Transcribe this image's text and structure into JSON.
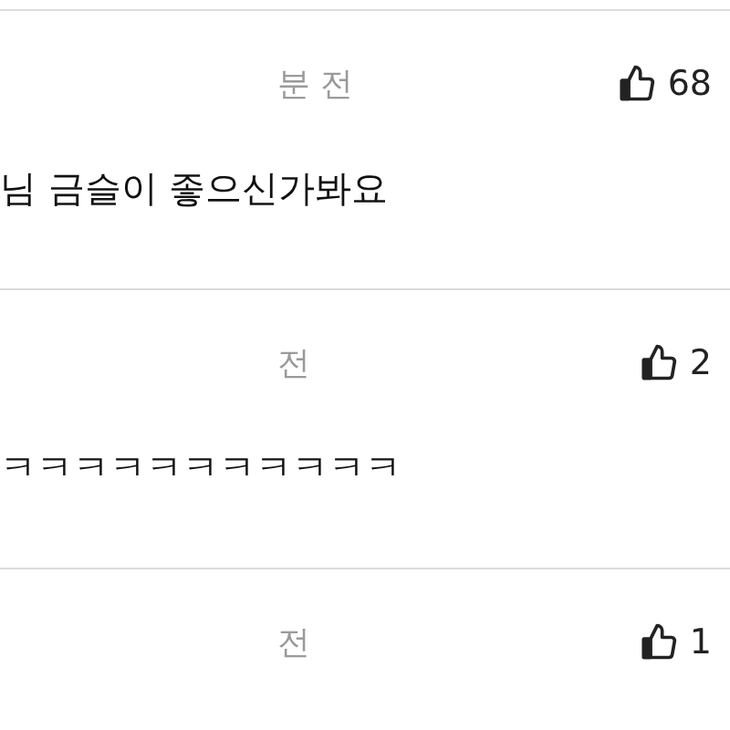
{
  "comments": [
    {
      "time": "분 전",
      "likes": "68",
      "text": "님 금슬이 좋으신가봐요"
    },
    {
      "time": "전",
      "likes": "2",
      "text": "ㅋㅋㅋㅋㅋㅋㅋㅋㅋㅋㅋ"
    },
    {
      "time": "전",
      "likes": "1"
    }
  ]
}
